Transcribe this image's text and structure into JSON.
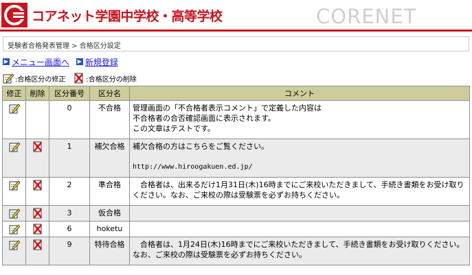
{
  "header": {
    "school_name": "コアネット学園中学校・高等学校",
    "brand": "CORENET"
  },
  "breadcrumb": "受験者合格発表管理 > 合格区分設定",
  "links": {
    "menu": "メニュー画面へ",
    "new": "新規登録"
  },
  "legend": {
    "edit": ":合格区分の修正",
    "delete": ":合格区分の削除"
  },
  "table": {
    "headers": {
      "edit": "修正",
      "delete": "削除",
      "number": "区分番号",
      "name": "区分名",
      "comment": "コメント"
    },
    "rows": [
      {
        "number": "0",
        "name": "不合格",
        "comment": "管理画面の「不合格者表示コメント」で定義した内容は\n不合格者の合否確認画面に表示されます。\nこの文章はテストです。"
      },
      {
        "number": "1",
        "name": "補欠合格",
        "comment_line1": "補欠合格の方はこちらをご覧ください。",
        "comment_url": "http://www.hiroogakuen.ed.jp/"
      },
      {
        "number": "2",
        "name": "準合格",
        "comment": "　合格者は、出来るだけ1月31日(木)16時までにご来校いただきまして、手続き書類をお受け取りください。なお、ご来校の際は受験票を必ずお持ちください。"
      },
      {
        "number": "3",
        "name": "仮合格",
        "comment": ""
      },
      {
        "number": "6",
        "name": "hoketu",
        "comment": ""
      },
      {
        "number": "9",
        "name": "特待合格",
        "comment": "　合格者は、1月24日(木)16時までにご来校いただきまして、手続き書類をお受け取りください。なお、ご来校の際は受験票を必ずお持ちください。"
      }
    ]
  },
  "colors": {
    "brand_red": "#c8141e",
    "header_bg": "#cfcc9c",
    "alt_row": "#ebebeb",
    "link": "#1a1adb"
  }
}
